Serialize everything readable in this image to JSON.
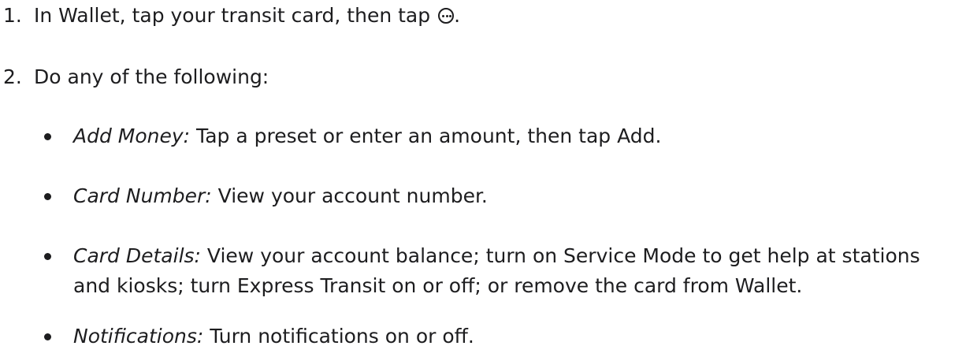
{
  "steps": [
    {
      "number": "1.",
      "text_before_icon": "In Wallet, tap your transit card, then tap ",
      "icon": "more-ellipsis-circle-icon",
      "text_after_icon": "."
    },
    {
      "number": "2.",
      "text": "Do any of the following:"
    }
  ],
  "options": [
    {
      "term": "Add Money:",
      "description": " Tap a preset or enter an amount, then tap Add."
    },
    {
      "term": "Card Number:",
      "description": " View your account number."
    },
    {
      "term": "Card Details:",
      "description": " View your account balance; turn on Service Mode to get help at stations and kiosks; turn Express Transit on or off; or remove the card from Wallet."
    },
    {
      "term": "Notifications:",
      "description": " Turn notifications on or off."
    }
  ]
}
